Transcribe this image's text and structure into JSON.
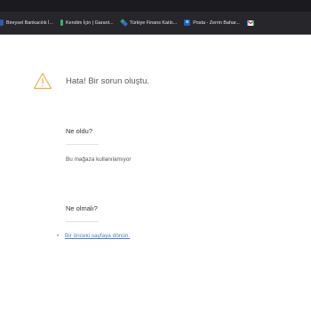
{
  "bookmarks": [
    {
      "label": "Bireysel Bankacılık İ...",
      "icon": "bank-icon"
    },
    {
      "label": "Kendim İçin | Garant...",
      "icon": "garanti-icon"
    },
    {
      "label": "Türkiye Finans Katılı...",
      "icon": "finans-icon"
    },
    {
      "label": "Posta - Zerrin Bahar...",
      "icon": "outlook-icon"
    },
    {
      "label": "",
      "icon": "gmail-icon"
    }
  ],
  "error": {
    "title": "Hata! Bir sorun oluştu.",
    "what_happened_heading": "Ne oldu?",
    "what_happened_text": "Bu mağaza kullanılamıyor",
    "what_should_heading": "Ne olmalı?",
    "back_link": "Bir önceki sayfaya dönün."
  },
  "colors": {
    "warning": "#f0ad4e",
    "link": "#4a7fd4"
  }
}
